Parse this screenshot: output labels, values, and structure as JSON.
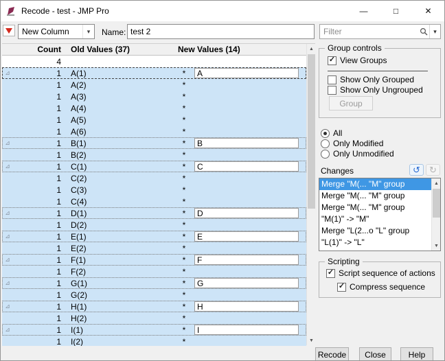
{
  "window": {
    "title": "Recode - test - JMP Pro",
    "minimize": "—",
    "maximize": "□",
    "close": "✕"
  },
  "toolbar": {
    "column_dropdown": "New Column",
    "name_label": "Name:",
    "name_value": "test 2",
    "filter_placeholder": "Filter"
  },
  "table": {
    "count_header": "Count",
    "old_header": "Old Values (37)",
    "new_header": "New Values (14)",
    "rows": [
      {
        "marker": false,
        "count": "4",
        "old": "",
        "star": "",
        "new_value": null,
        "selected": false
      },
      {
        "marker": true,
        "count": "1",
        "old": "A(1)",
        "star": "*",
        "new_value": "A",
        "selected": true,
        "focus": true
      },
      {
        "marker": false,
        "count": "1",
        "old": "A(2)",
        "star": "*",
        "new_value": null,
        "selected": true
      },
      {
        "marker": false,
        "count": "1",
        "old": "A(3)",
        "star": "*",
        "new_value": null,
        "selected": true
      },
      {
        "marker": false,
        "count": "1",
        "old": "A(4)",
        "star": "*",
        "new_value": null,
        "selected": true
      },
      {
        "marker": false,
        "count": "1",
        "old": "A(5)",
        "star": "*",
        "new_value": null,
        "selected": true
      },
      {
        "marker": false,
        "count": "1",
        "old": "A(6)",
        "star": "*",
        "new_value": null,
        "selected": true
      },
      {
        "marker": true,
        "count": "1",
        "old": "B(1)",
        "star": "*",
        "new_value": "B",
        "selected": true
      },
      {
        "marker": false,
        "count": "1",
        "old": "B(2)",
        "star": "*",
        "new_value": null,
        "selected": true
      },
      {
        "marker": true,
        "count": "1",
        "old": "C(1)",
        "star": "*",
        "new_value": "C",
        "selected": true
      },
      {
        "marker": false,
        "count": "1",
        "old": "C(2)",
        "star": "*",
        "new_value": null,
        "selected": true
      },
      {
        "marker": false,
        "count": "1",
        "old": "C(3)",
        "star": "*",
        "new_value": null,
        "selected": true
      },
      {
        "marker": false,
        "count": "1",
        "old": "C(4)",
        "star": "*",
        "new_value": null,
        "selected": true
      },
      {
        "marker": true,
        "count": "1",
        "old": "D(1)",
        "star": "*",
        "new_value": "D",
        "selected": true
      },
      {
        "marker": false,
        "count": "1",
        "old": "D(2)",
        "star": "*",
        "new_value": null,
        "selected": true
      },
      {
        "marker": true,
        "count": "1",
        "old": "E(1)",
        "star": "*",
        "new_value": "E",
        "selected": true
      },
      {
        "marker": false,
        "count": "1",
        "old": "E(2)",
        "star": "*",
        "new_value": null,
        "selected": true
      },
      {
        "marker": true,
        "count": "1",
        "old": "F(1)",
        "star": "*",
        "new_value": "F",
        "selected": true
      },
      {
        "marker": false,
        "count": "1",
        "old": "F(2)",
        "star": "*",
        "new_value": null,
        "selected": true
      },
      {
        "marker": true,
        "count": "1",
        "old": "G(1)",
        "star": "*",
        "new_value": "G",
        "selected": true
      },
      {
        "marker": false,
        "count": "1",
        "old": "G(2)",
        "star": "*",
        "new_value": null,
        "selected": true
      },
      {
        "marker": true,
        "count": "1",
        "old": "H(1)",
        "star": "*",
        "new_value": "H",
        "selected": true
      },
      {
        "marker": false,
        "count": "1",
        "old": "H(2)",
        "star": "*",
        "new_value": null,
        "selected": true
      },
      {
        "marker": true,
        "count": "1",
        "old": "I(1)",
        "star": "*",
        "new_value": "I",
        "selected": true
      },
      {
        "marker": false,
        "count": "1",
        "old": "I(2)",
        "star": "*",
        "new_value": null,
        "selected": true
      }
    ]
  },
  "group_controls": {
    "legend": "Group controls",
    "view_groups": "View Groups",
    "show_only_grouped": "Show Only Grouped",
    "show_only_ungrouped": "Show Only Ungrouped",
    "group_button": "Group"
  },
  "filter_options": {
    "all": "All",
    "only_modified": "Only Modified",
    "only_unmodified": "Only Unmodified",
    "selected": "All"
  },
  "changes": {
    "label": "Changes",
    "items": [
      {
        "text": "Merge \"M(... \"M\" group",
        "selected": true
      },
      {
        "text": "Merge \"M(... \"M\" group",
        "selected": false
      },
      {
        "text": "Merge \"M(... \"M\" group",
        "selected": false
      },
      {
        "text": "\"M(1)\" -> \"M\"",
        "selected": false
      },
      {
        "text": "Merge \"L(2...o \"L\" group",
        "selected": false
      },
      {
        "text": "\"L(1)\" -> \"L\"",
        "selected": false
      }
    ]
  },
  "scripting": {
    "legend": "Scripting",
    "script_sequence": "Script sequence of actions",
    "compress_sequence": "Compress sequence"
  },
  "buttons": {
    "recode": "Recode",
    "close": "Close",
    "help": "Help"
  },
  "icons": {
    "check": "✓",
    "chevron_down": "▾",
    "scroll_up": "▲",
    "scroll_down": "▼",
    "undo": "↺",
    "redo": "↻",
    "group_marker": "⊿"
  },
  "colors": {
    "selection": "#cde4f7",
    "list_selection": "#3f97e4",
    "red_triangle": "#d42a1e"
  }
}
